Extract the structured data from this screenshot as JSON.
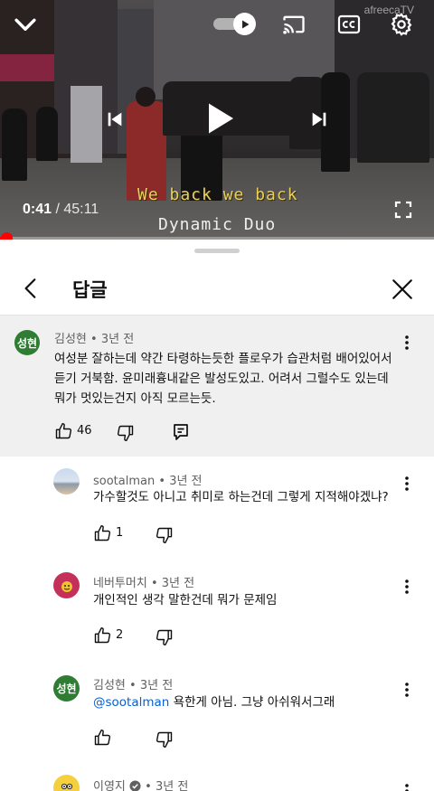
{
  "player": {
    "current_time": "0:41",
    "separator": " / ",
    "total_time": "45:11",
    "progress": 0.015,
    "subtitle_line1": "We back we back",
    "subtitle_line2": "Dynamic Duo",
    "watermark": "afreecaTV",
    "icons": [
      "chevron-down-icon",
      "autoplay-toggle-icon",
      "cast-icon",
      "closed-captions-icon",
      "settings-gear-icon",
      "previous-icon",
      "play-icon",
      "next-icon",
      "fullscreen-icon"
    ]
  },
  "sheet": {
    "title": "답글",
    "back_icon": "chevron-left-icon",
    "close_icon": "close-icon"
  },
  "parent_comment": {
    "avatar_text": "성현",
    "avatar_color": "#2e7d32",
    "author": "김성현",
    "time": "3년 전",
    "lines": [
      "여성분 잘하는데 약간 타령하는듯한 플로우가 습관처럼 배어있어서",
      "듣기 거북함. 윤미래흉내같은 발성도있고.  어려서 그럴수도 있는데",
      "뭐가 멋있는건지 아직 모르는듯."
    ],
    "likes": "46"
  },
  "replies": [
    {
      "author": "sootalman",
      "time": "3년 전",
      "text": "가수할것도 아니고 취미로 하는건데 그렇게 지적해야겠냐?",
      "likes": "1",
      "avatar": "landscape-avatar"
    },
    {
      "author": "네버투머치",
      "time": "3년 전",
      "text": "개인적인 생각 말한건데 뭐가 문제임",
      "likes": "2",
      "avatar": "pink-character-avatar"
    },
    {
      "author": "김성현",
      "time": "3년 전",
      "avatar_text": "성현",
      "mention": "@sootalman",
      "text": "욕한게 아님. 그냥 아쉬워서그래",
      "likes": ""
    },
    {
      "author": "이영지",
      "time": "3년 전",
      "verified": true,
      "avatar": "character-avatar"
    }
  ],
  "separator_dot": "•",
  "colors": {
    "accent_red": "#ff0000",
    "link_blue": "#065fd4",
    "parent_bg": "#f0f0f0"
  }
}
